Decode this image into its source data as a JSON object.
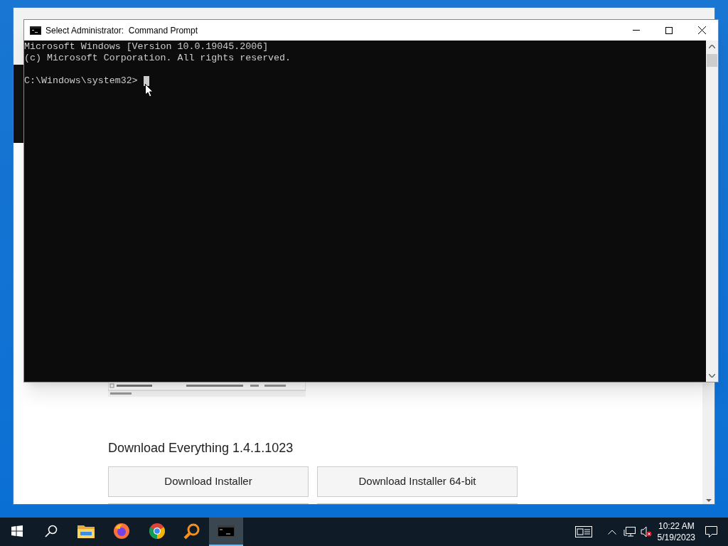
{
  "browser": {
    "heading": "Download Everything 1.4.1.1023",
    "buttons": [
      "Download Installer",
      "Download Installer 64-bit"
    ]
  },
  "console": {
    "title": "Select Administrator:  Command Prompt",
    "lines": [
      "Microsoft Windows [Version 10.0.19045.2006]",
      "(c) Microsoft Corporation. All rights reserved."
    ],
    "prompt": "C:\\Windows\\system32>"
  },
  "taskbar": {
    "apps": [
      {
        "kind": "start",
        "selected": false
      },
      {
        "kind": "search",
        "selected": false
      },
      {
        "kind": "explorer",
        "selected": false
      },
      {
        "kind": "firefox",
        "selected": false
      },
      {
        "kind": "chrome",
        "selected": false
      },
      {
        "kind": "everything",
        "selected": false
      },
      {
        "kind": "cmd",
        "selected": true
      }
    ],
    "time": "10:22 AM",
    "date": "5/19/2023"
  }
}
